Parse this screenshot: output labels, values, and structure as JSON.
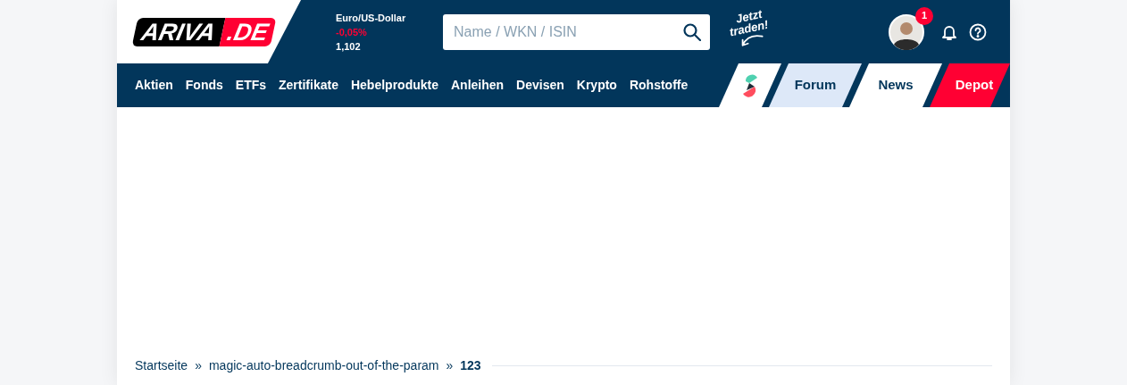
{
  "logo": {
    "main": "ARIVA",
    "suffix": ".DE"
  },
  "ticker": {
    "name": "Euro/US-Dollar",
    "change": "-0,05%",
    "price": "1,102"
  },
  "search": {
    "placeholder": "Name / WKN / ISIN"
  },
  "promo": {
    "line_1": "Jetzt",
    "line_2": "traden!"
  },
  "user": {
    "notification_count": "1"
  },
  "nav": [
    "Aktien",
    "Fonds",
    "ETFs",
    "Zertifikate",
    "Hebelprodukte",
    "Anleihen",
    "Devisen",
    "Krypto",
    "Rohstoffe"
  ],
  "tabs": [
    {
      "kind": "app",
      "selected": false
    },
    {
      "kind": "text",
      "label": "Forum",
      "selected": true
    },
    {
      "kind": "text",
      "label": "News",
      "selected": false
    },
    {
      "kind": "accent",
      "label": "Depot",
      "selected": false
    }
  ],
  "breadcrumb": [
    {
      "label": "Startseite",
      "current": false
    },
    {
      "label": "magic-auto-breadcrumb-out-of-the-param",
      "current": false
    },
    {
      "label": "123",
      "current": true
    }
  ],
  "breadcrumb_separator": "»"
}
